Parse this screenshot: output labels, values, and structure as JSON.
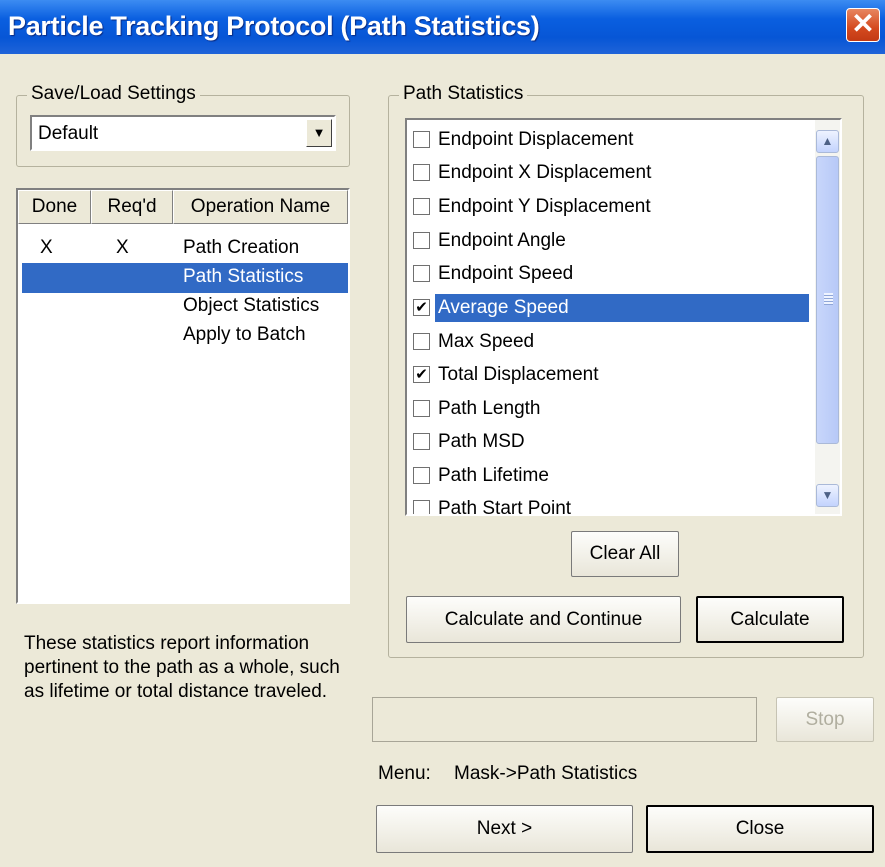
{
  "window": {
    "title": "Particle Tracking Protocol (Path Statistics)",
    "close_glyph": "✕"
  },
  "settings": {
    "group_label": "Save/Load Settings",
    "selected": "Default",
    "dropdown_glyph": "▼"
  },
  "operations": {
    "columns": [
      "Done",
      "Req'd",
      "Operation Name"
    ],
    "rows": [
      {
        "done": "X",
        "reqd": "X",
        "name": "Path Creation"
      },
      {
        "done": "",
        "reqd": "",
        "name": "Path Statistics",
        "selected": true
      },
      {
        "done": "",
        "reqd": "",
        "name": "Object Statistics"
      },
      {
        "done": "",
        "reqd": "",
        "name": "Apply to Batch"
      }
    ]
  },
  "description": "These statistics report information pertinent to the path as a whole, such as lifetime or total distance traveled.",
  "path_statistics": {
    "group_label": "Path Statistics",
    "items": [
      {
        "label": "Endpoint Displacement",
        "checked": false
      },
      {
        "label": "Endpoint X Displacement",
        "checked": false
      },
      {
        "label": "Endpoint Y Displacement",
        "checked": false
      },
      {
        "label": "Endpoint Angle",
        "checked": false
      },
      {
        "label": "Endpoint Speed",
        "checked": false
      },
      {
        "label": "Average Speed",
        "checked": true,
        "selected": true
      },
      {
        "label": "Max Speed",
        "checked": false
      },
      {
        "label": "Total Displacement",
        "checked": true
      },
      {
        "label": "Path Length",
        "checked": false
      },
      {
        "label": "Path MSD",
        "checked": false
      },
      {
        "label": "Path Lifetime",
        "checked": false
      },
      {
        "label": "Path Start Point",
        "checked": false
      }
    ],
    "check_glyph": "✔",
    "scroll_up_glyph": "▲",
    "scroll_down_glyph": "▼"
  },
  "buttons": {
    "clear_all": "Clear All",
    "calculate_and_continue": "Calculate and Continue",
    "calculate": "Calculate",
    "stop": "Stop",
    "next": "Next >",
    "close": "Close"
  },
  "menu": {
    "label": "Menu:",
    "path": "Mask->Path Statistics"
  },
  "colors": {
    "title_bar": "#0756d6",
    "selection": "#316ac5",
    "window_bg": "#ece9d8",
    "close_button": "#d44a1f"
  }
}
